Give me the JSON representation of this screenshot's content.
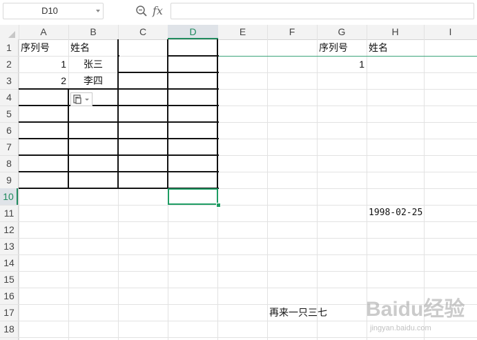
{
  "formula_bar": {
    "name_box": "D10",
    "zoom_icon": "zoom-search-icon",
    "fx_label": "fx",
    "formula_value": ""
  },
  "columns": [
    "A",
    "B",
    "C",
    "D",
    "E",
    "F",
    "G",
    "H",
    "I"
  ],
  "selected_column": "D",
  "rows": [
    "1",
    "2",
    "3",
    "4",
    "5",
    "6",
    "7",
    "8",
    "9",
    "10",
    "11",
    "12",
    "13",
    "14",
    "15",
    "16",
    "17",
    "18"
  ],
  "selected_row": "10",
  "cells": {
    "A1": "序列号",
    "B1": "姓名",
    "A2": "1",
    "B2": "张三",
    "A3": "2",
    "B3": "李四",
    "G1": "序列号",
    "H1": "姓名",
    "G2": "1",
    "H11": "1998-02-25",
    "F17": "再来一只三七"
  },
  "paste_options_icon": "paste-options-icon",
  "watermark": {
    "text": "Baidu经验",
    "url": "jingyan.baidu.com"
  },
  "colors": {
    "selection": "#1e9c63",
    "grid": "#e2e2e2",
    "header_bg": "#f3f3f3"
  }
}
